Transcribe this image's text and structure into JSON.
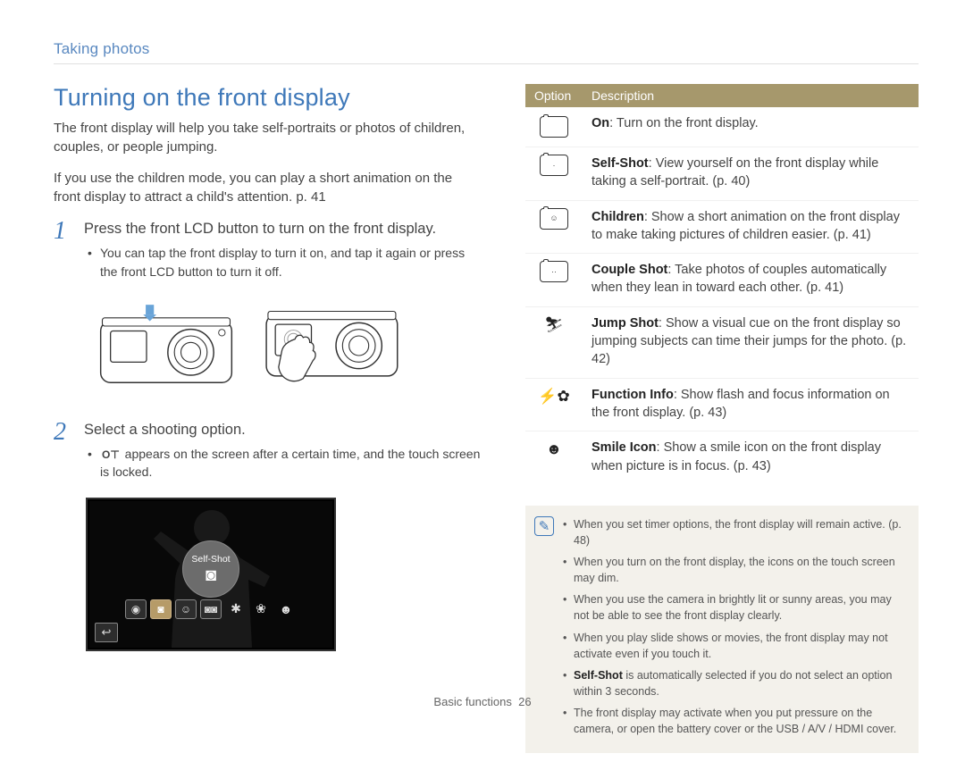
{
  "breadcrumb": "Taking photos",
  "heading": "Turning on the front display",
  "intro1": "The front display will help you take self-portraits or photos of children, couples, or people jumping.",
  "intro2": "If you use the children mode, you can play a short animation on the front display to attract a child's attention. p. 41",
  "step1": {
    "num": "1",
    "title": "Press the front LCD button to turn on the front display.",
    "bullet": "You can tap the front display to turn it on, and tap it again or press the front LCD button to turn it off."
  },
  "step2": {
    "num": "2",
    "title": "Select a shooting option.",
    "bullet_before": "",
    "key_icon": "O⊤",
    "bullet_after": " appears on the screen after a certain time, and the touch screen is locked."
  },
  "screenshot": {
    "bubble_label": "Self-Shot",
    "icons": [
      {
        "name": "on-icon",
        "glyph": "◉",
        "boxed": true
      },
      {
        "name": "self-shot-icon",
        "glyph": "◙",
        "boxed": true,
        "selected": true
      },
      {
        "name": "children-icon",
        "glyph": "☺",
        "boxed": true
      },
      {
        "name": "couple-shot-icon",
        "glyph": "◙◙",
        "boxed": true
      },
      {
        "name": "jump-shot-icon",
        "glyph": "✱",
        "boxed": false
      },
      {
        "name": "function-info-icon",
        "glyph": "❀",
        "boxed": false
      },
      {
        "name": "smile-icon",
        "glyph": "☻",
        "boxed": false
      }
    ],
    "back_glyph": "↩"
  },
  "table": {
    "headers": {
      "option": "Option",
      "description": "Description"
    },
    "rows": [
      {
        "icon_name": "on-icon",
        "icon_style": "cam",
        "icon_glyph": "",
        "label": "On",
        "desc": ": Turn on the front display."
      },
      {
        "icon_name": "self-shot-icon",
        "icon_style": "cam",
        "icon_glyph": "·",
        "label": "Self-Shot",
        "desc": ": View yourself on the front display while taking a self-portrait. (p. 40)"
      },
      {
        "icon_name": "children-icon",
        "icon_style": "cam",
        "icon_glyph": "☺",
        "label": "Children",
        "desc": ": Show a short animation on the front display to make taking pictures of children easier. (p. 41)"
      },
      {
        "icon_name": "couple-shot-icon",
        "icon_style": "cam",
        "icon_glyph": "··",
        "label": "Couple Shot",
        "desc": ": Take photos of couples automatically when they lean in toward each other. (p. 41)"
      },
      {
        "icon_name": "jump-shot-icon",
        "icon_style": "plain",
        "icon_glyph": "⛷",
        "label": "Jump Shot",
        "desc": ": Show a visual cue on the front display so jumping subjects can time their jumps for the photo. (p. 42)"
      },
      {
        "icon_name": "function-info-icon",
        "icon_style": "plain",
        "icon_glyph": "⚡✿",
        "label": "Function Info",
        "desc": ": Show flash and focus information on the front display. (p. 43)"
      },
      {
        "icon_name": "smile-icon",
        "icon_style": "plain",
        "icon_glyph": "☻",
        "label": "Smile Icon",
        "desc": ": Show a smile icon on the front display when picture is in focus. (p. 43)"
      }
    ]
  },
  "notes": [
    {
      "before": "When you set timer options, the front display will remain active. (p. 48)",
      "bold": "",
      "after": ""
    },
    {
      "before": "When you turn on the front display, the icons on the touch screen may dim.",
      "bold": "",
      "after": ""
    },
    {
      "before": "When you use the camera in brightly lit or sunny areas, you may not be able to see the front display clearly.",
      "bold": "",
      "after": ""
    },
    {
      "before": "When you play slide shows or movies, the front display may not activate even if you touch it.",
      "bold": "",
      "after": ""
    },
    {
      "before": "",
      "bold": "Self-Shot",
      "after": " is automatically selected if you do not select an option within 3 seconds."
    },
    {
      "before": "The front display may activate when you put pressure on the camera, or open the battery cover or the USB / A/V / HDMI cover.",
      "bold": "",
      "after": ""
    }
  ],
  "footer": {
    "section": "Basic functions",
    "page": "26"
  }
}
